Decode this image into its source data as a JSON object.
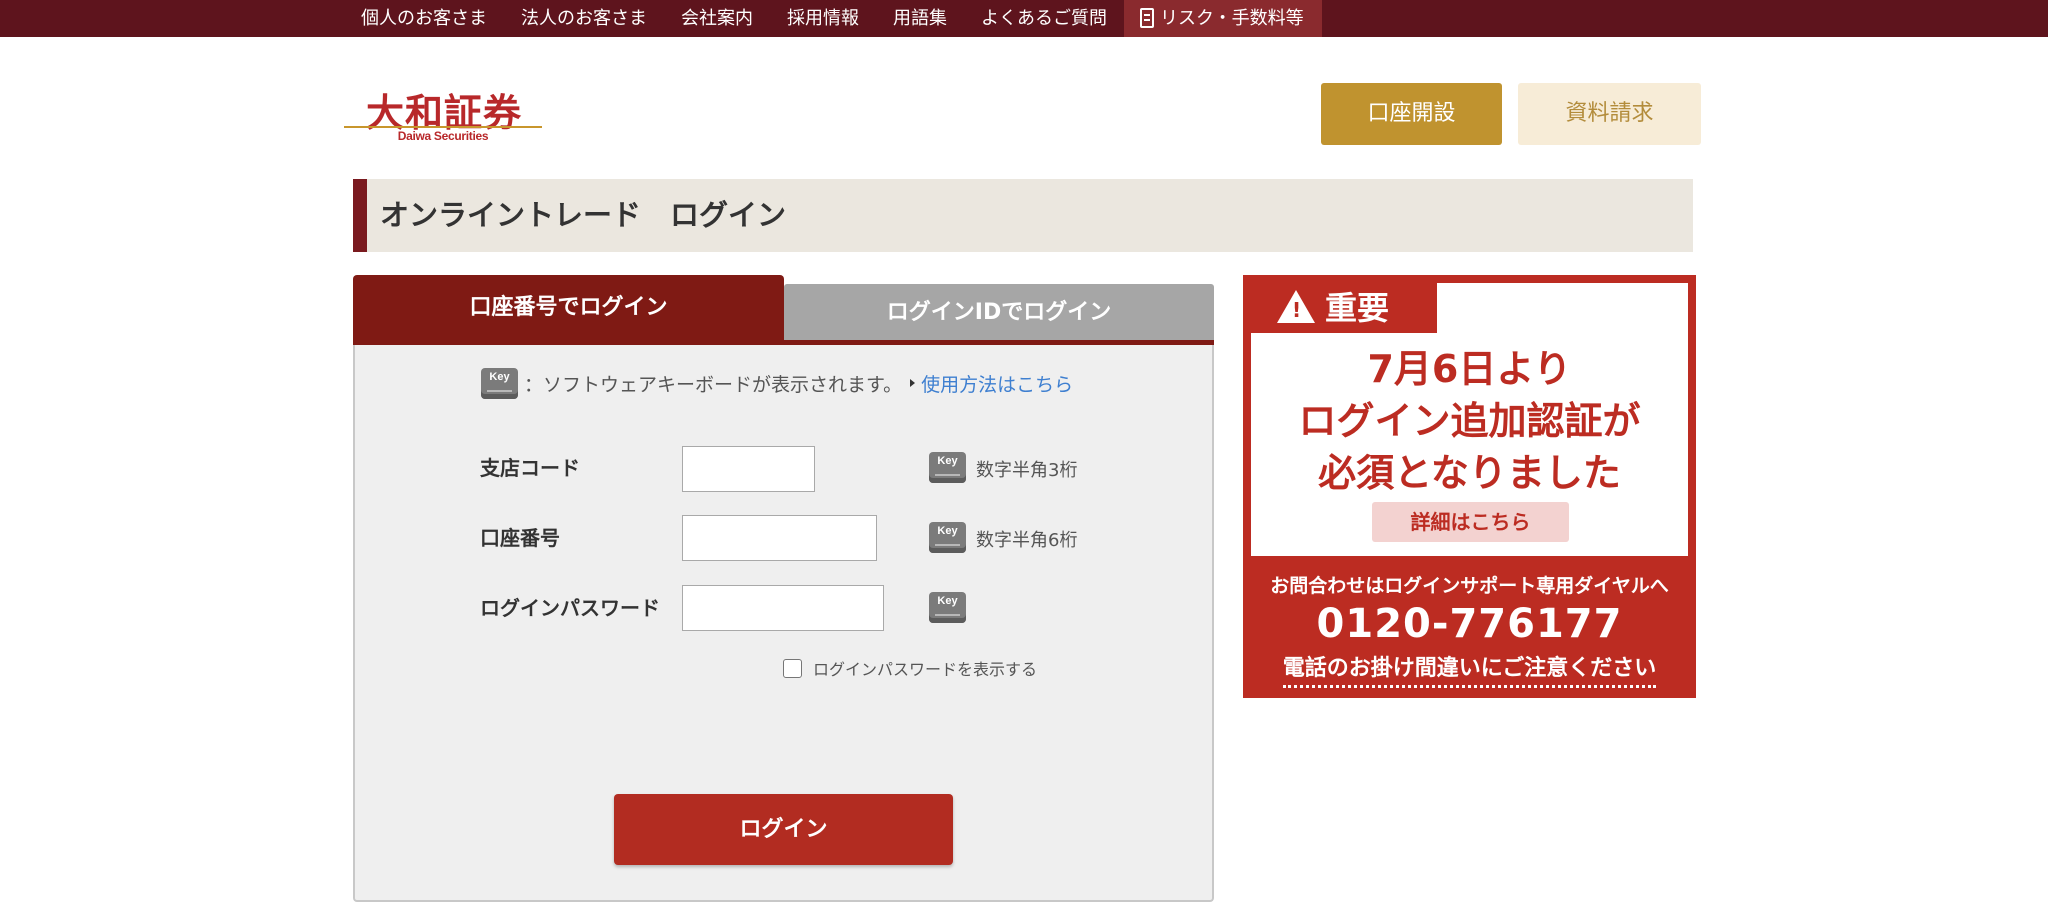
{
  "topnav": {
    "items": [
      "個人のお客さま",
      "法人のお客さま",
      "会社案内",
      "採用情報",
      "用語集",
      "よくあるご質問"
    ],
    "risk_label": "リスク・手数料等"
  },
  "header": {
    "logo_jp": "大和証券",
    "logo_en": "Daiwa Securities",
    "open_account_label": "口座開設",
    "request_docs_label": "資料請求"
  },
  "page": {
    "title": "オンライントレード　ログイン"
  },
  "login": {
    "tabs": [
      "口座番号でログイン",
      "ログインIDでログイン"
    ],
    "keyboard_notice": "：ソフトウェアキーボードが表示されます。",
    "usage_link": "使用方法はこちら",
    "fields": [
      {
        "label": "支店コード",
        "value": "",
        "hint": "数字半角3桁"
      },
      {
        "label": "口座番号",
        "value": "",
        "hint": "数字半角6桁"
      },
      {
        "label": "ログインパスワード",
        "value": "",
        "hint": ""
      }
    ],
    "show_password_label": "ログインパスワードを表示する",
    "show_password_checked": false,
    "submit_label": "ログイン"
  },
  "banner": {
    "badge": "重要",
    "headline": [
      "7月6日より",
      "ログイン追加認証が",
      "必須となりました"
    ],
    "detail_button": "詳細はこちら",
    "contact_lead": "お問合わせはログインサポート専用ダイヤルへ",
    "phone": "0120-776177",
    "caution": "電話のお掛け間違いにご注意ください"
  },
  "colors": {
    "nav_bg": "#5e141d",
    "accent_red": "#7f1a14",
    "login_button": "#b22c21",
    "gold": "#c0932f",
    "banner_red": "#bc2c22"
  },
  "icons": [
    "document-icon",
    "keyboard-key-icon",
    "warning-icon"
  ]
}
